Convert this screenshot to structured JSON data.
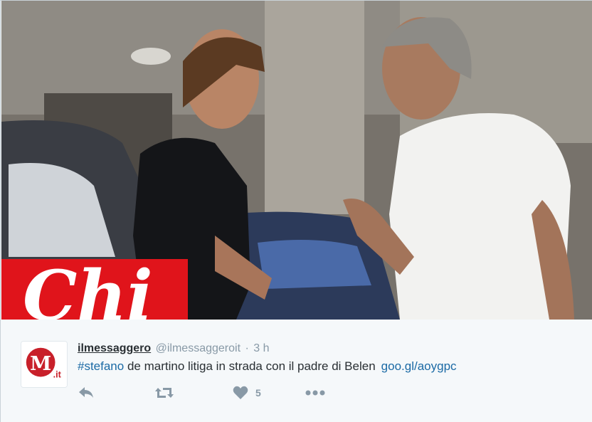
{
  "photo": {
    "watermark_text": "Chi",
    "watermark_color": "#e0141b"
  },
  "tweet": {
    "avatar_icon": "il-messaggero-logo",
    "avatar_mark": "M",
    "avatar_suffix": ".it",
    "user_name": "ilmessaggero",
    "user_handle": "@ilmessaggeroit",
    "separator": "·",
    "timestamp": "3 h",
    "hashtag": "#stefano",
    "text": " de martino litiga in strada con il padre di Belen",
    "link": "goo.gl/aoygpc"
  },
  "actions": {
    "reply_icon": "reply-icon",
    "retweet_icon": "retweet-icon",
    "like_icon": "heart-icon",
    "like_count": "5",
    "more_icon": "more-dots-icon"
  },
  "colors": {
    "accent": "#1b6aa5",
    "muted": "#8899a6",
    "text": "#292f33",
    "background": "#f5f8fa"
  }
}
